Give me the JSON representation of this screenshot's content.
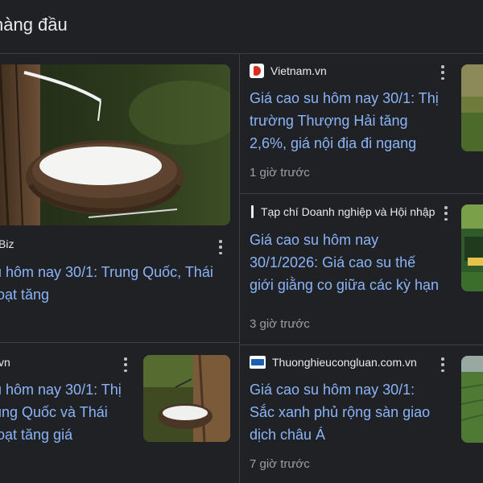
{
  "section": {
    "title": "hàng đầu"
  },
  "left": {
    "top_card": {
      "source": "Biz",
      "headline_lines": [
        "u hôm nay 30/1: Trung Quốc, Thái",
        "loạt tăng"
      ]
    },
    "bottom_card": {
      "source": "vn",
      "headline_lines": [
        "u hôm nay 30/1: Thị",
        "ung Quốc và Thái",
        "loạt tăng giá"
      ]
    }
  },
  "right": {
    "cards": [
      {
        "source": "Vietnam.vn",
        "favicon": "vietnam-vn-favicon",
        "headline_lines": [
          "Giá cao su hôm nay 30/1: Thị",
          "trường Thượng Hải tăng",
          "2,6%, giá nội địa đi ngang"
        ],
        "time": "1 giờ trước"
      },
      {
        "source": "Tạp chí Doanh nghiệp và Hội nhập",
        "favicon": "doanh-nghiep-favicon",
        "headline_lines": [
          "Giá cao su hôm nay",
          "30/1/2026: Giá cao su thế",
          "giới giằng co giữa các kỳ hạn"
        ],
        "time": "3 giờ trước"
      },
      {
        "source": "Thuonghieucongluan.com.vn",
        "favicon": "thuonghieucongluan-favicon",
        "headline_lines": [
          "Giá cao su hôm nay 30/1:",
          "Sắc xanh phủ rộng sàn giao",
          "dịch châu Á"
        ],
        "time": "7 giờ trước"
      }
    ]
  },
  "colors": {
    "background": "#202124",
    "headline": "#8ab4f8",
    "text": "#e8eaed",
    "muted": "#9aa0a6",
    "divider": "#3c4043"
  },
  "icons": {
    "menu": "more-vert-icon"
  }
}
